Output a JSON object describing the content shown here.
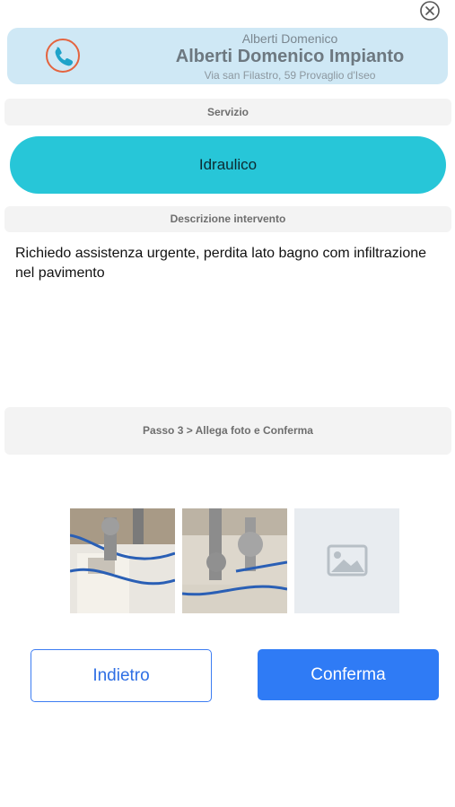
{
  "header": {
    "subtitle": "Alberti Domenico",
    "title": "Alberti Domenico Impianto",
    "address": "Via san Filastro, 59 Provaglio d'Iseo",
    "icon": "phone-icon"
  },
  "service": {
    "section_label": "Servizio",
    "selected": "Idraulico"
  },
  "description": {
    "section_label": "Descrizione intervento",
    "text": "Richiedo assistenza urgente, perdita lato bagno com infiltrazione nel pavimento"
  },
  "step": {
    "label": "Passo 3 > Allega foto e Conferma"
  },
  "photos": {
    "items": [
      "plumbing-photo-1",
      "plumbing-photo-2"
    ],
    "placeholder_icon": "image-placeholder-icon"
  },
  "actions": {
    "back_label": "Indietro",
    "confirm_label": "Conferma"
  },
  "colors": {
    "header_bg": "#cfe8f5",
    "service_pill": "#27c6d8",
    "primary": "#2f7bf5"
  }
}
